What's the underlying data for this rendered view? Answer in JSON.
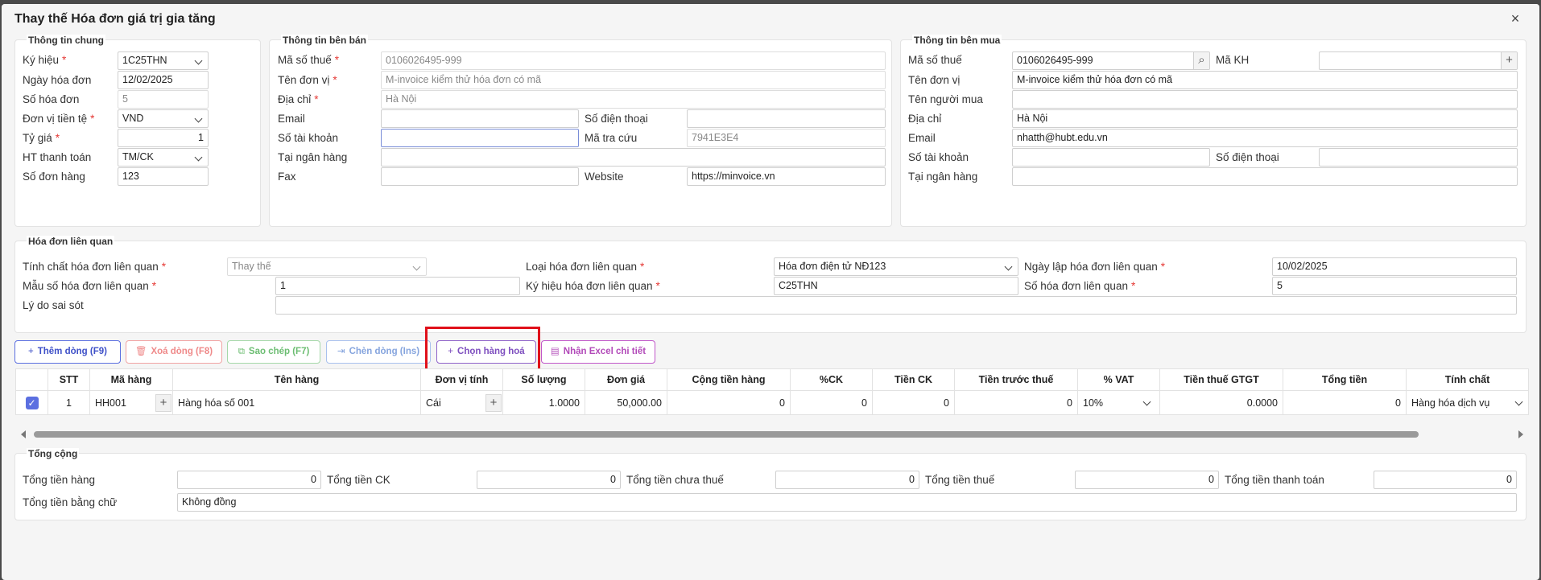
{
  "dialog": {
    "title": "Thay thế Hóa đơn giá trị gia tăng",
    "close": "×"
  },
  "general": {
    "legend": "Thông tin chung",
    "symbol_label": "Ký hiệu",
    "symbol_value": "1C25THN",
    "date_label": "Ngày hóa đơn",
    "date_value": "12/02/2025",
    "number_label": "Số hóa đơn",
    "number_value": "5",
    "currency_label": "Đơn vị tiền tệ",
    "currency_value": "VND",
    "rate_label": "Tỷ giá",
    "rate_value": "1",
    "payment_label": "HT thanh toán",
    "payment_value": "TM/CK",
    "order_label": "Số đơn hàng",
    "order_value": "123"
  },
  "seller": {
    "legend": "Thông tin bên bán",
    "tax_label": "Mã số thuế",
    "tax_value": "0106026495-999",
    "name_label": "Tên đơn vị",
    "name_value": "M-invoice kiểm thử hóa đơn có mã",
    "address_label": "Địa chỉ",
    "address_value": "Hà Nội",
    "email_label": "Email",
    "email_value": "",
    "phone_label": "Số điện thoại",
    "phone_value": "",
    "account_label": "Số tài khoản",
    "account_value": "",
    "lookup_label": "Mã tra cứu",
    "lookup_value": "7941E3E4",
    "bank_label": "Tại ngân hàng",
    "bank_value": "",
    "fax_label": "Fax",
    "fax_value": "",
    "website_label": "Website",
    "website_value": "https://minvoice.vn"
  },
  "buyer": {
    "legend": "Thông tin bên mua",
    "tax_label": "Mã số thuế",
    "tax_value": "0106026495-999",
    "code_label": "Mã KH",
    "code_value": "",
    "name_label": "Tên đơn vị",
    "name_value": "M-invoice kiểm thử hóa đơn có mã",
    "buyer_label": "Tên người mua",
    "buyer_value": "",
    "address_label": "Địa chỉ",
    "address_value": "Hà Nội",
    "email_label": "Email",
    "email_value": "nhatth@hubt.edu.vn",
    "account_label": "Số tài khoản",
    "account_value": "",
    "phone_label": "Số điện thoại",
    "phone_value": "",
    "bank_label": "Tại ngân hàng",
    "bank_value": ""
  },
  "related": {
    "legend": "Hóa đơn liên quan",
    "nature_label": "Tính chất hóa đơn liên quan",
    "nature_value": "Thay thế",
    "type_label": "Loại hóa đơn liên quan",
    "type_value": "Hóa đơn điện tử NĐ123",
    "date_label": "Ngày lập hóa đơn liên quan",
    "date_value": "10/02/2025",
    "template_label": "Mẫu số hóa đơn liên quan",
    "template_value": "1",
    "symbol_label": "Ký hiệu hóa đơn liên quan",
    "symbol_value": "C25THN",
    "number_label": "Số hóa đơn liên quan",
    "number_value": "5",
    "reason_label": "Lý do sai sót",
    "reason_value": ""
  },
  "toolbar": {
    "add": "Thêm dòng (F9)",
    "delete": "Xoá dòng (F8)",
    "copy": "Sao chép (F7)",
    "insert": "Chèn dòng (Ins)",
    "choose": "Chọn hàng hoá",
    "excel": "Nhận Excel chi tiết"
  },
  "grid": {
    "headers": [
      "STT",
      "Mã hàng",
      "Tên hàng",
      "Đơn vị tính",
      "Số lượng",
      "Đơn giá",
      "Cộng tiền hàng",
      "%CK",
      "Tiền CK",
      "Tiền trước thuế",
      "% VAT",
      "Tiền thuế GTGT",
      "Tổng tiền",
      "Tính chất"
    ],
    "row": {
      "stt": "1",
      "code": "HH001",
      "name": "Hàng hóa số 001",
      "unit": "Cái",
      "qty": "1.0000",
      "price": "50,000.00",
      "amount": "0",
      "ck_pct": "0",
      "ck": "0",
      "before_tax": "0",
      "vat": "10%",
      "vat_amount": "0.0000",
      "total": "0",
      "nature": "Hàng hóa dịch vụ"
    }
  },
  "totals": {
    "legend": "Tổng cộng",
    "goods_label": "Tổng tiền hàng",
    "goods_value": "0",
    "ck_label": "Tổng tiền CK",
    "ck_value": "0",
    "pretax_label": "Tổng tiền chưa thuế",
    "pretax_value": "0",
    "tax_label": "Tổng tiền thuế",
    "tax_value": "0",
    "pay_label": "Tổng tiền thanh toán",
    "pay_value": "0",
    "words_label": "Tổng tiền bằng chữ",
    "words_value": "Không đồng"
  }
}
